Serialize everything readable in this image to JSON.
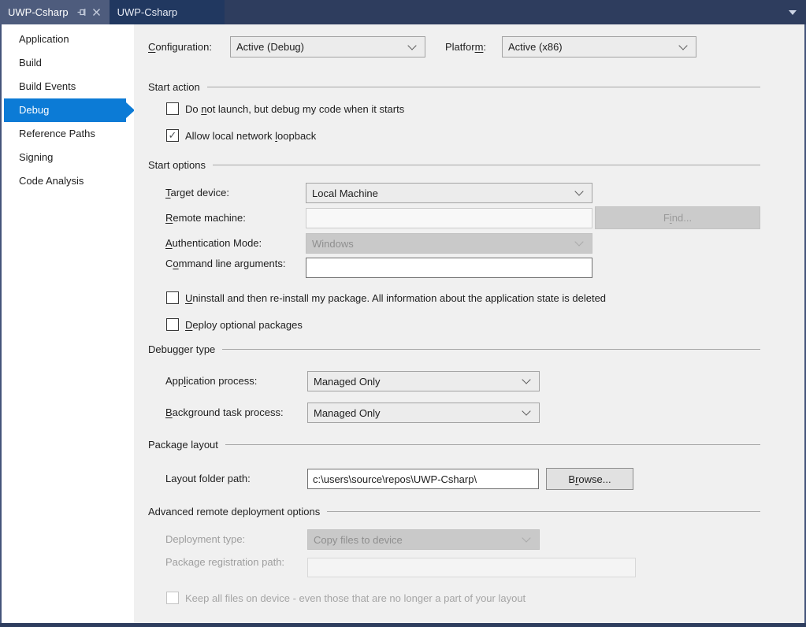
{
  "colors": {
    "accent_selection": "#0c7bd6",
    "tabbar_background": "#2e3d5e",
    "focused_tab_background": "#4e5c7d",
    "unfocused_tab_background": "#213860",
    "page_background": "#f0f0f0",
    "sidebar_background": "#ffffff"
  },
  "tabbar": {
    "tabs": [
      {
        "label": "UWP-Csharp",
        "state": "focused"
      },
      {
        "label": "UWP-Csharp",
        "state": "unfocused"
      }
    ]
  },
  "sidebar": {
    "items": [
      {
        "label": "Application",
        "selected": false
      },
      {
        "label": "Build",
        "selected": false
      },
      {
        "label": "Build Events",
        "selected": false
      },
      {
        "label": "Debug",
        "selected": true
      },
      {
        "label": "Reference Paths",
        "selected": false
      },
      {
        "label": "Signing",
        "selected": false
      },
      {
        "label": "Code Analysis",
        "selected": false
      }
    ]
  },
  "toolbar": {
    "configuration_label": "&Configuration:",
    "configuration_value": "Active (Debug)",
    "platform_label": "Platfor&m:",
    "platform_value": "Active (x86)"
  },
  "start_action": {
    "title": "Start action",
    "do_not_launch": {
      "label": "Do &not launch, but debug my code when it starts",
      "checked": false
    },
    "loopback": {
      "label": "Allow local network &loopback",
      "checked": true
    }
  },
  "start_options": {
    "title": "Start options",
    "target_device": {
      "label": "&Target device:",
      "value": "Local Machine"
    },
    "remote_machine": {
      "label": "&Remote machine:",
      "value": ""
    },
    "find_button": {
      "label": "F&ind..."
    },
    "authentication_mode": {
      "label": "&Authentication Mode:",
      "value": "Windows"
    },
    "command_line": {
      "label": "C&ommand line arguments:",
      "value": ""
    },
    "uninstall": {
      "label": "&Uninstall and then re-install my package. All information about the application state is deleted",
      "checked": false
    },
    "deploy_optional": {
      "label": "&Deploy optional packages",
      "checked": false
    }
  },
  "debugger_type": {
    "title": "Debugger type",
    "application_process": {
      "label": "App&lication process:",
      "value": "Managed Only"
    },
    "background_task": {
      "label": "&Background task process:",
      "value": "Managed Only"
    }
  },
  "package_layout": {
    "title": "Package layout",
    "layout_folder_path": {
      "label": "Layout folder path:",
      "value": "c:\\users\\source\\repos\\UWP-Csharp\\"
    },
    "browse_button": {
      "label": "B&rowse..."
    }
  },
  "advanced": {
    "title": "Advanced remote deployment options",
    "deployment_type": {
      "label": "Deployment type:",
      "value": "Copy files to device"
    },
    "package_registration": {
      "label": "Package registration path:",
      "value": ""
    },
    "keep_files": {
      "label": "Keep all files on device - even those that are no longer a part of your layout",
      "checked": false
    }
  }
}
